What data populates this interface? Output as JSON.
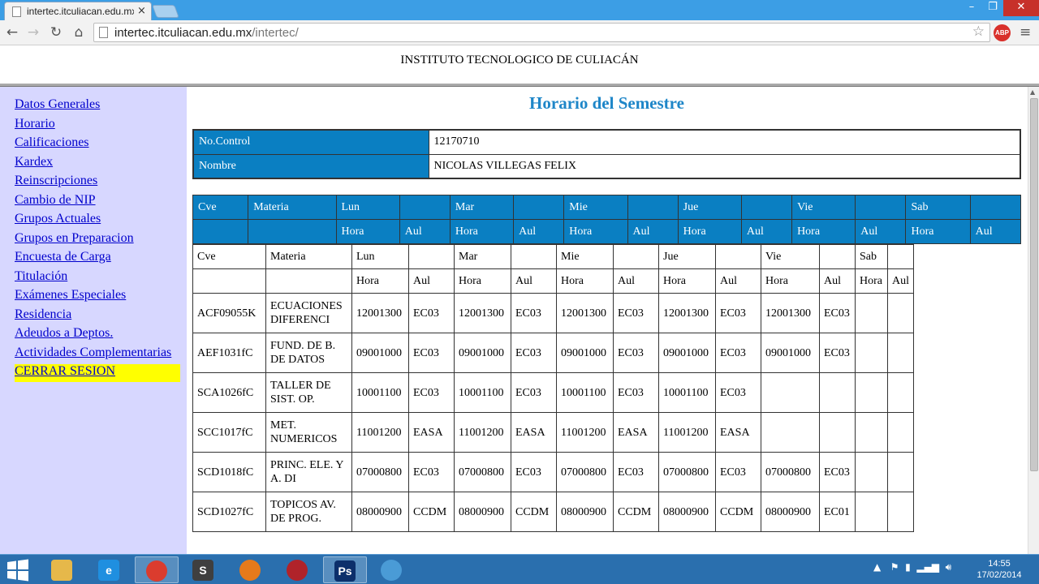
{
  "browser": {
    "tab_title": "intertec.itculiacan.edu.mx",
    "tab_close": "×",
    "url_host": "intertec.itculiacan.edu.mx",
    "url_path": "/intertec/",
    "abp_label": "ABP",
    "win_min": "–",
    "win_max": "❐",
    "win_close": "✕"
  },
  "header": {
    "institute": "INSTITUTO TECNOLOGICO DE CULIACÁN"
  },
  "sidebar": {
    "items": [
      {
        "label": "Datos Generales"
      },
      {
        "label": "Horario"
      },
      {
        "label": "Calificaciones"
      },
      {
        "label": "Kardex"
      },
      {
        "label": "Reinscripciones"
      },
      {
        "label": "Cambio de NIP"
      },
      {
        "label": "Grupos Actuales"
      },
      {
        "label": "Grupos en Preparacion"
      },
      {
        "label": "Encuesta de Carga"
      },
      {
        "label": "Titulación"
      },
      {
        "label": "Exámenes Especiales"
      },
      {
        "label": "Residencia"
      },
      {
        "label": "Adeudos a Deptos."
      },
      {
        "label": "Actividades Complementarias"
      },
      {
        "label": "CERRAR SESION"
      }
    ]
  },
  "main": {
    "title": "Horario del Semestre",
    "info": {
      "control_label": "No.Control",
      "control_value": "12170710",
      "name_label": "Nombre",
      "name_value": "NICOLAS VILLEGAS FELIX"
    },
    "header_row1": [
      "Cve",
      "Materia",
      "Lun",
      "",
      "Mar",
      "",
      "Mie",
      "",
      "Jue",
      "",
      "Vie",
      "",
      "Sab",
      ""
    ],
    "header_row2": [
      "",
      "",
      "Hora",
      "Aul",
      "Hora",
      "Aul",
      "Hora",
      "Aul",
      "Hora",
      "Aul",
      "Hora",
      "Aul",
      "Hora",
      "Aul"
    ],
    "grid_header1": [
      "Cve",
      "Materia",
      "Lun",
      "",
      "Mar",
      "",
      "Mie",
      "",
      "Jue",
      "",
      "Vie",
      "",
      "Sab",
      ""
    ],
    "grid_header2": [
      "",
      "",
      "Hora",
      "Aul",
      "Hora",
      "Aul",
      "Hora",
      "Aul",
      "Hora",
      "Aul",
      "Hora",
      "Aul",
      "Hora",
      "Aul"
    ],
    "rows": [
      [
        "ACF09055K",
        "ECUACIONES DIFERENCI",
        "12001300",
        "EC03",
        "12001300",
        "EC03",
        "12001300",
        "EC03",
        "12001300",
        "EC03",
        "12001300",
        "EC03",
        "",
        ""
      ],
      [
        "AEF1031fC",
        "FUND. DE B. DE DATOS",
        "09001000",
        "EC03",
        "09001000",
        "EC03",
        "09001000",
        "EC03",
        "09001000",
        "EC03",
        "09001000",
        "EC03",
        "",
        ""
      ],
      [
        "SCA1026fC",
        "TALLER DE SIST. OP.",
        "10001100",
        "EC03",
        "10001100",
        "EC03",
        "10001100",
        "EC03",
        "10001100",
        "EC03",
        "",
        "",
        "",
        ""
      ],
      [
        "SCC1017fC",
        "MET. NUMERICOS",
        "11001200",
        "EASA",
        "11001200",
        "EASA",
        "11001200",
        "EASA",
        "11001200",
        "EASA",
        "",
        "",
        "",
        ""
      ],
      [
        "SCD1018fC",
        "PRINC. ELE. Y A. DI",
        "07000800",
        "EC03",
        "07000800",
        "EC03",
        "07000800",
        "EC03",
        "07000800",
        "EC03",
        "07000800",
        "EC03",
        "",
        ""
      ],
      [
        "SCD1027fC",
        "TOPICOS AV. DE PROG.",
        "08000900",
        "CCDM",
        "08000900",
        "CCDM",
        "08000900",
        "CCDM",
        "08000900",
        "CCDM",
        "08000900",
        "EC01",
        "",
        ""
      ]
    ]
  },
  "taskbar": {
    "clock_time": "14:55",
    "clock_date": "17/02/2014",
    "apps": [
      {
        "name": "file-explorer",
        "color": "#e6b84a",
        "glyph": ""
      },
      {
        "name": "internet-explorer",
        "color": "#1f8fe0",
        "glyph": "e"
      },
      {
        "name": "chrome",
        "color": "#db3c2e",
        "glyph": "",
        "active": true
      },
      {
        "name": "sublime",
        "color": "#3f3f3f",
        "glyph": "S"
      },
      {
        "name": "firefox",
        "color": "#e67a1b",
        "glyph": ""
      },
      {
        "name": "app-red",
        "color": "#b0232a",
        "glyph": ""
      },
      {
        "name": "photoshop",
        "color": "#0c2f6b",
        "glyph": "Ps",
        "active": true
      },
      {
        "name": "paint",
        "color": "#4a9bd6",
        "glyph": ""
      }
    ]
  }
}
